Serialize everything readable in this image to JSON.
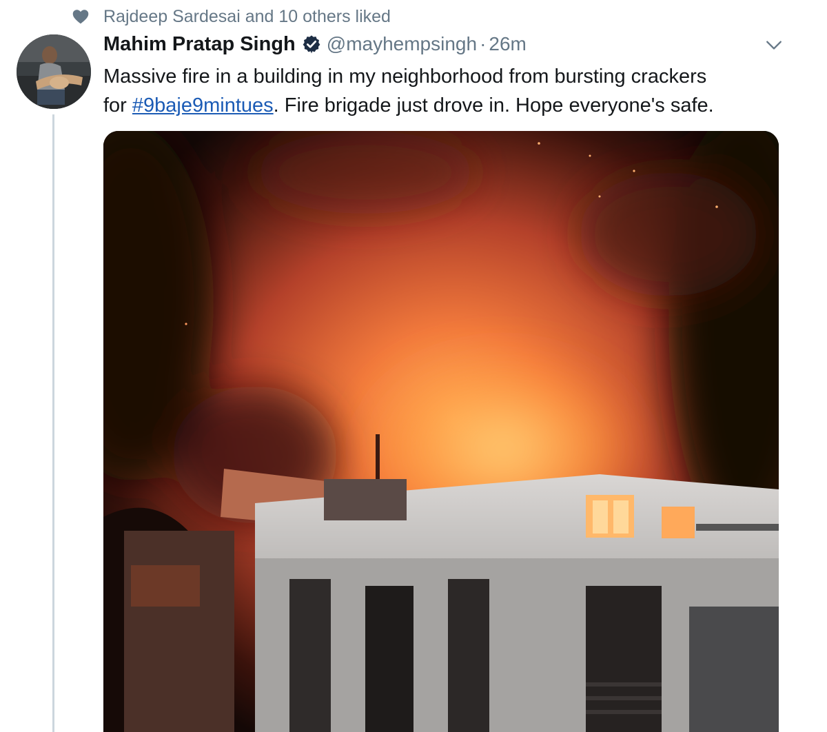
{
  "social_context": {
    "text": "Rajdeep Sardesai and 10 others liked",
    "icon": "heart-icon"
  },
  "tweet": {
    "author_name": "Mahim Pratap Singh",
    "verified": true,
    "handle": "@mayhempsingh",
    "separator": "·",
    "time": "26m",
    "text_line1": "Massive fire in a building in my neighborhood from bursting crackers",
    "text_prefix": "for ",
    "hashtag": "#9baje9mintues",
    "text_suffix": ". Fire brigade just drove in. Hope everyone's safe.",
    "media": {
      "type": "video-still",
      "subject": "building-on-fire-at-night"
    }
  },
  "colors": {
    "text": "#14171a",
    "secondary": "#657786",
    "link": "#1b5bb5",
    "verified": "#1da1f2",
    "thread_line": "#ccd6dd"
  }
}
